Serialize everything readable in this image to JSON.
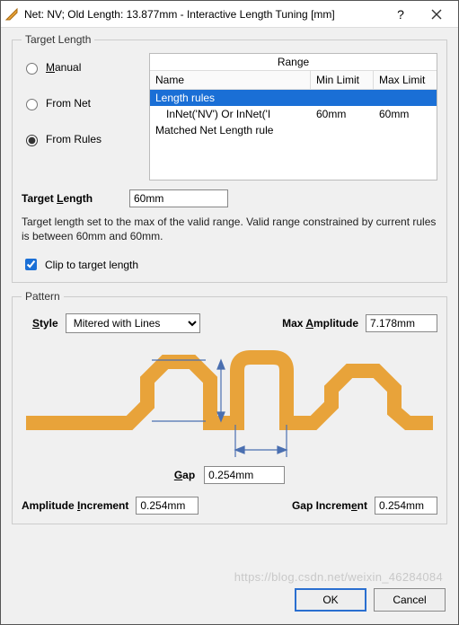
{
  "titlebar": {
    "title": "Net: NV;  Old Length: 13.877mm -  Interactive Length Tuning [mm]"
  },
  "target_length": {
    "legend": "Target Length",
    "radio_manual": "Manual",
    "radio_fromnet": "From Net",
    "radio_fromrules": "From Rules",
    "selected": "fromrules",
    "range": {
      "title": "Range",
      "col_name": "Name",
      "col_min": "Min Limit",
      "col_max": "Max Limit",
      "rows": [
        {
          "name": "Length rules",
          "min": "",
          "max": "",
          "selected": true
        },
        {
          "name": "InNet('NV') Or InNet('I",
          "min": "60mm",
          "max": "60mm",
          "indent": true
        },
        {
          "name": "Matched Net Length rule",
          "min": "",
          "max": ""
        }
      ]
    },
    "field_label": "Target Length",
    "field_value": "60mm",
    "help_text": "Target length set to the max of the valid range. Valid range constrained by current rules is between 60mm and 60mm.",
    "clip_label": "Clip to target length",
    "clip_checked": true
  },
  "pattern": {
    "legend": "Pattern",
    "style_label": "Style",
    "style_value": "Mitered with Lines",
    "max_amp_label": "Max Amplitude",
    "max_amp_value": "7.178mm",
    "gap_label": "Gap",
    "gap_value": "0.254mm",
    "amp_inc_label": "Amplitude Increment",
    "amp_inc_value": "0.254mm",
    "gap_inc_label": "Gap Increment",
    "gap_inc_value": "0.254mm"
  },
  "footer": {
    "ok": "OK",
    "cancel": "Cancel"
  },
  "watermark": "https://blog.csdn.net/weixin_46284084"
}
